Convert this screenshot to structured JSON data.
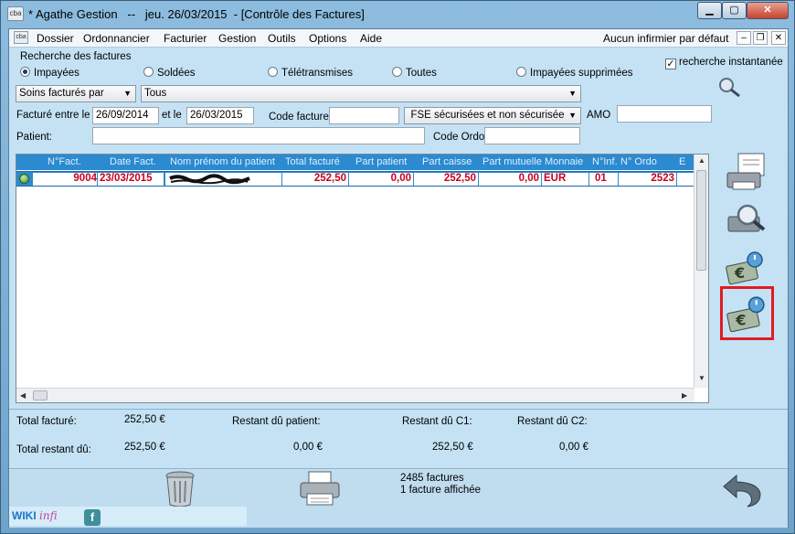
{
  "window": {
    "title": "* Agathe Gestion   --   jeu. 26/03/2015  - [Contrôle des Factures]",
    "icon_text": "cba"
  },
  "menu": {
    "items": [
      "Dossier",
      "Ordonnancier",
      "Facturier",
      "Gestion",
      "Outils",
      "Options",
      "Aide"
    ],
    "right_text": "Aucun infirmier par défaut"
  },
  "search": {
    "label": "Recherche des factures",
    "radios": [
      {
        "label": "Impayées",
        "checked": true
      },
      {
        "label": "Soldées",
        "checked": false
      },
      {
        "label": "Télétransmises",
        "checked": false
      },
      {
        "label": "Toutes",
        "checked": false
      },
      {
        "label": "Impayées supprimées",
        "checked": false
      }
    ],
    "instant_label": "recherche instantanée",
    "instant_checked": true,
    "soins_select": "Soins facturés par",
    "soins_value": "Tous",
    "facture_entre_label": "Facturé entre le",
    "date_from": "26/09/2014",
    "et_le_label": "et le",
    "date_to": "26/03/2015",
    "code_facture_label": "Code facture",
    "code_facture_value": "",
    "fse_select": "FSE sécurisées et non sécurisée",
    "amo_label": "AMO",
    "amo_value": "",
    "patient_label": "Patient:",
    "patient_value": "",
    "code_ordo_label": "Code Ordo",
    "code_ordo_value": ""
  },
  "grid": {
    "columns": [
      "N°Fact.",
      "Date Fact.",
      "Nom prénom du patient",
      "Total facturé",
      "Part patient",
      "Part caisse",
      "Part mutuelle",
      "Monnaie",
      "N°Inf.",
      "N° Ordo",
      "E"
    ],
    "rows": [
      {
        "num": "9004",
        "date": "23/03/2015",
        "patient": "",
        "total": "252,50",
        "part_patient": "0,00",
        "part_caisse": "252,50",
        "part_mutuelle": "0,00",
        "monnaie": "EUR",
        "inf": "01",
        "ordo": "2523"
      }
    ]
  },
  "totals": {
    "total_facture_label": "Total facturé:",
    "total_facture": "252,50 €",
    "restant_patient_label": "Restant dû patient:",
    "restant_c1_label": "Restant dû C1:",
    "restant_c2_label": "Restant dû C2:",
    "total_restant_label": "Total restant dû:",
    "total_restant": "252,50 €",
    "restant_patient": "0,00 €",
    "restant_c1": "252,50 €",
    "restant_c2": "0,00 €"
  },
  "status": {
    "count": "2485 factures",
    "shown": "1 facture affichée"
  },
  "footer": {
    "wiki": "WIKI",
    "infi": "infi",
    "fb": "f"
  },
  "colors": {
    "header_blue": "#2b8ad0",
    "value_red": "#c8001e",
    "highlight_red": "#e01c24"
  }
}
